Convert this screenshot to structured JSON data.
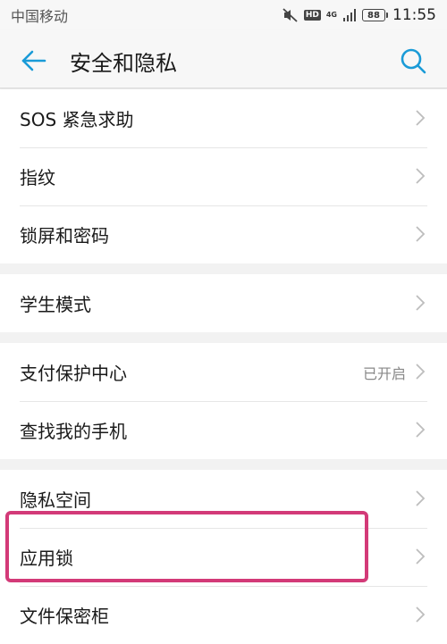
{
  "status_bar": {
    "carrier": "中国移动",
    "network": "4G",
    "hd_badge": "HD",
    "battery": "88",
    "time": "11:55",
    "icons": [
      "mute-icon",
      "hd-icon",
      "network-4g-icon",
      "signal-icon",
      "battery-icon"
    ]
  },
  "header": {
    "title": "安全和隐私",
    "back_icon": "back-arrow-icon",
    "search_icon": "search-icon"
  },
  "groups": [
    {
      "items": [
        {
          "label": "SOS 紧急求助"
        },
        {
          "label": "指纹"
        },
        {
          "label": "锁屏和密码"
        }
      ]
    },
    {
      "items": [
        {
          "label": "学生模式"
        }
      ]
    },
    {
      "items": [
        {
          "label": "支付保护中心",
          "status": "已开启"
        },
        {
          "label": "查找我的手机"
        }
      ]
    },
    {
      "items": [
        {
          "label": "隐私空间"
        },
        {
          "label": "应用锁",
          "highlighted": true
        },
        {
          "label": "文件保密柜"
        }
      ]
    }
  ],
  "colors": {
    "accent": "#1a9bd7",
    "highlight": "#d33a78",
    "background": "#f2f2f2"
  }
}
